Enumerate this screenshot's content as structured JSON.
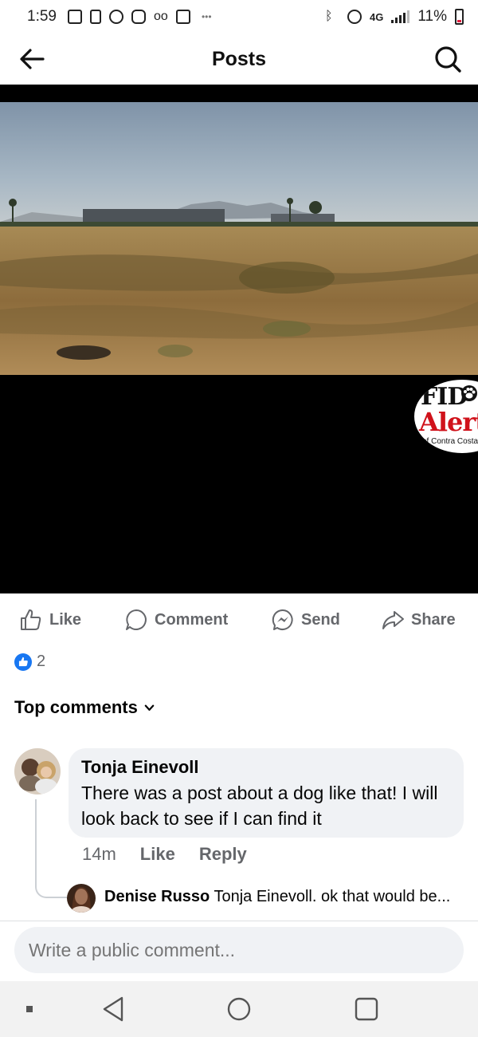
{
  "status_bar": {
    "time": "1:59",
    "battery": "11%",
    "network": "4G"
  },
  "header": {
    "title": "Posts"
  },
  "media": {
    "logo_line1": "FID",
    "logo_line2": "Alert",
    "logo_line3": "of Contra Costa Coun"
  },
  "actions": {
    "like": "Like",
    "comment": "Comment",
    "send": "Send",
    "share": "Share"
  },
  "reactions": {
    "count": "2"
  },
  "comments_section": {
    "filter_label": "Top comments"
  },
  "comment": {
    "author": "Tonja Einevoll",
    "text": "There was a post about a dog like that! I will look back to see if I can find it",
    "time": "14m",
    "like_label": "Like",
    "reply_label": "Reply"
  },
  "reply": {
    "author": "Denise Russo",
    "text": "Tonja Einevoll. ok that would be..."
  },
  "composer": {
    "placeholder": "Write a public comment..."
  },
  "colors": {
    "accent": "#1877f2",
    "secondary_text": "#65676b",
    "bubble": "#f0f2f5"
  }
}
